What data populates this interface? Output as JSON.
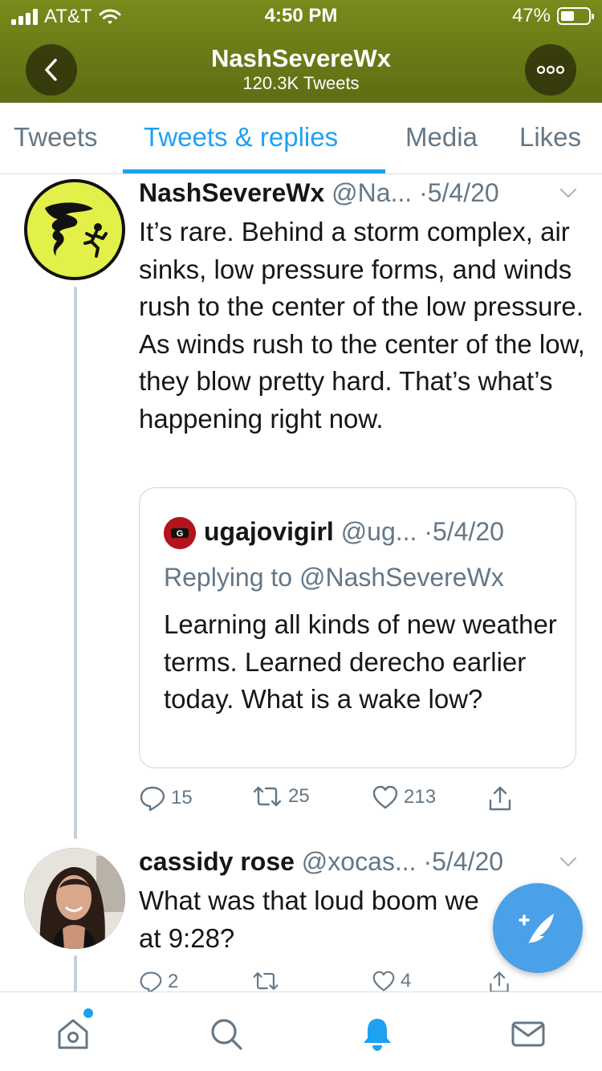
{
  "status_bar": {
    "carrier": "AT&T",
    "time": "4:50 PM",
    "battery": "47%"
  },
  "header": {
    "name": "NashSevereWx",
    "tweet_count": "120.3K Tweets",
    "accent_color": "#6b7d17"
  },
  "tabs": [
    {
      "label": "Tweets"
    },
    {
      "label": "Tweets & replies"
    },
    {
      "label": "Media"
    },
    {
      "label": "Likes"
    }
  ],
  "tweets": [
    {
      "display_name": "NashSevereWx",
      "handle": "@Na...",
      "date": "·5/4/20",
      "text": "It’s rare. Behind a storm complex, air sinks, low pressure forms, and winds rush to the center of the low pressure. As winds rush to the center of the low, they blow pretty hard. That’s what’s happening right now.",
      "quote": {
        "display_name": "ugajovigirl",
        "handle": "@ug...",
        "date": "·5/4/20",
        "replying_to": "Replying to @NashSevereWx",
        "text": "Learning all kinds of new weather terms. Learned derecho earlier today. What is a wake low?"
      },
      "replies": "15",
      "retweets": "25",
      "likes": "213"
    },
    {
      "display_name": "cassidy rose",
      "handle": "@xocas...",
      "date": "·5/4/20",
      "text": "What was that loud boom we",
      "text_line2": "at 9:28?",
      "replies": "2",
      "retweets": "",
      "likes": "4"
    }
  ],
  "colors": {
    "twitter_blue": "#1da1f2",
    "muted_text": "#657786",
    "fab_blue": "#4aa1e8",
    "storm_avatar_yellow": "#e3f04a"
  },
  "icons": {
    "back": "chevron-left-icon",
    "more": "more-horizontal-icon",
    "reply": "reply-icon",
    "retweet": "retweet-icon",
    "like": "heart-icon",
    "share": "share-icon",
    "compose": "compose-feather-icon",
    "home": "home-icon",
    "search": "search-icon",
    "notifications": "bell-icon",
    "messages": "mail-icon"
  }
}
